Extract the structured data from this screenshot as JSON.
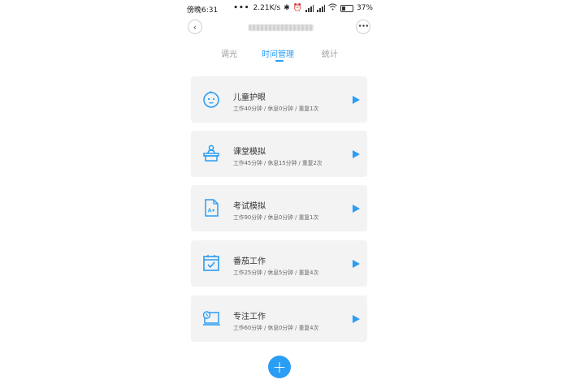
{
  "statusbar": {
    "time": "傍晚6:31",
    "speed": "2.21K/s",
    "battery": "37%"
  },
  "tabs": [
    {
      "label": "调光",
      "active": false
    },
    {
      "label": "时间管理",
      "active": true
    },
    {
      "label": "统计",
      "active": false
    }
  ],
  "cards": [
    {
      "title": "儿童护眼",
      "subtitle": "工作40分钟 / 休息0分钟 / 重复1次",
      "icon": "child-face-icon"
    },
    {
      "title": "课堂模拟",
      "subtitle": "工作45分钟 / 休息15分钟 / 重复2次",
      "icon": "classroom-desk-icon"
    },
    {
      "title": "考试模拟",
      "subtitle": "工作90分钟 / 休息0分钟 / 重复1次",
      "icon": "exam-paper-icon"
    },
    {
      "title": "番茄工作",
      "subtitle": "工作25分钟 / 休息5分钟 / 重复4次",
      "icon": "calendar-check-icon"
    },
    {
      "title": "专注工作",
      "subtitle": "工作60分钟 / 休息0分钟 / 重复4次",
      "icon": "laptop-clock-icon"
    }
  ],
  "fab": {
    "label": "+"
  },
  "colors": {
    "accent": "#2a9df4",
    "card_bg": "#f3f3f3",
    "tab_inactive": "#9b9b9b"
  }
}
